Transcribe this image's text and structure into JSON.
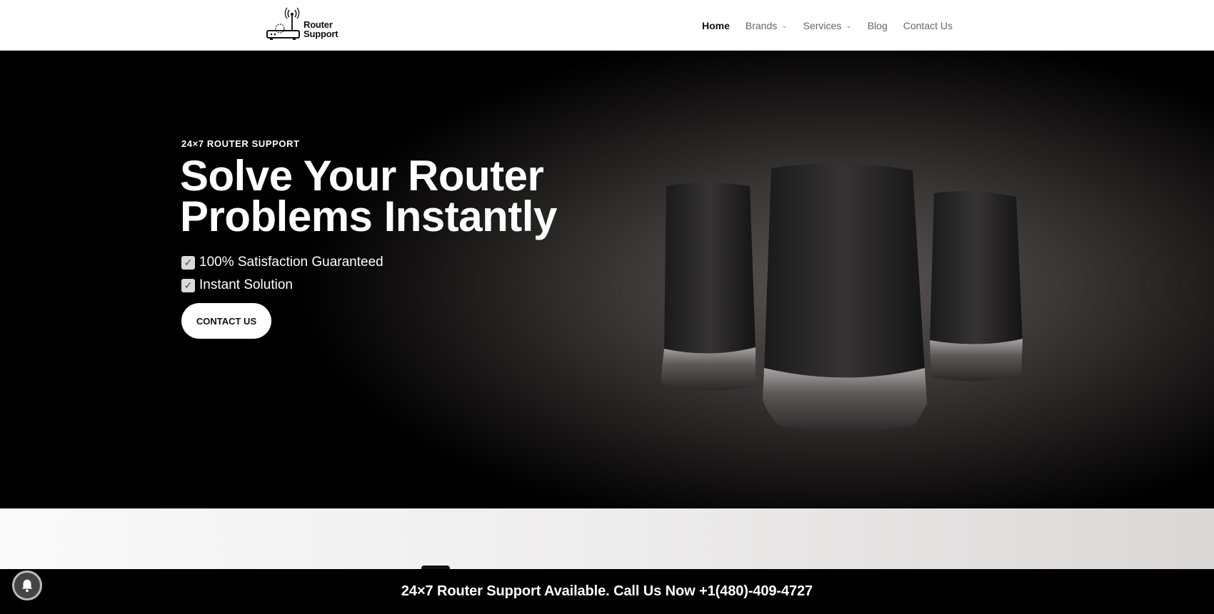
{
  "header": {
    "logo_line1": "Router",
    "logo_line2": "Support",
    "nav": [
      {
        "label": "Home"
      },
      {
        "label": "Brands",
        "chevron": "chevron-down-icon"
      },
      {
        "label": "Services",
        "chevron": "chevron-down-icon"
      },
      {
        "label": "Blog"
      },
      {
        "label": "Contact Us"
      }
    ]
  },
  "hero": {
    "tagline": "24×7 ROUTER SUPPORT",
    "title_line1": "Solve Your Router",
    "title_line2": "Problems Instantly",
    "checks": [
      {
        "icon": "checkbox-icon",
        "label": "100% Satisfaction Guaranteed"
      },
      {
        "icon": "checkbox-icon",
        "label": "Instant Solution"
      }
    ],
    "cta_label": "CONTACT US"
  },
  "bottom_bar": {
    "text": "24×7 Router Support Available. Call Us Now +1(480)-409-4727"
  },
  "colors": {
    "header_bg": "#ffffff",
    "hero_bg": "#000000",
    "accent": "#ffffff",
    "bar_bg": "#000000"
  }
}
